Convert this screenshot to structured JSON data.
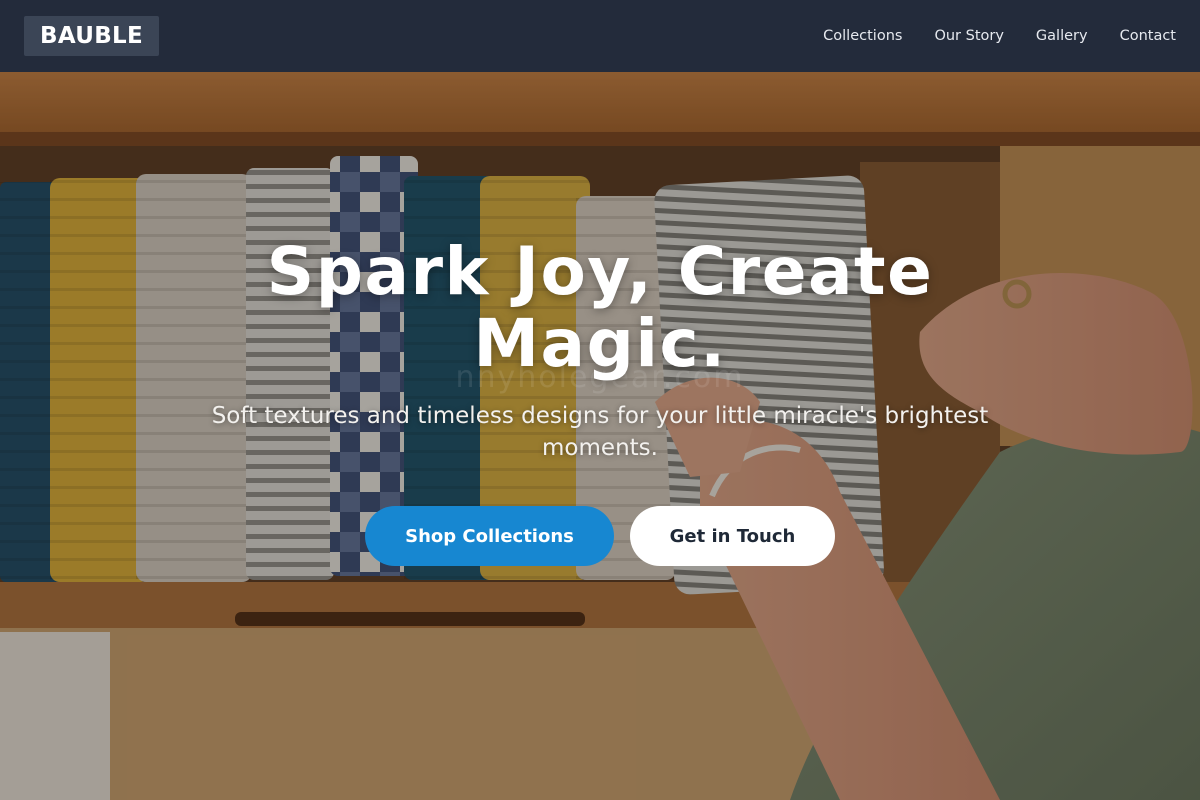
{
  "brand": {
    "logo_text": "BAUBLE"
  },
  "nav": {
    "links": [
      {
        "label": "Collections"
      },
      {
        "label": "Our Story"
      },
      {
        "label": "Gallery"
      },
      {
        "label": "Contact"
      }
    ]
  },
  "hero": {
    "title": "Spark Joy, Create Magic.",
    "subtitle": "Soft textures and timeless designs for your little miracle's brightest moments.",
    "watermark": "nnyholegear.com",
    "image_subject": "drawer-of-folded-muslin-blankets",
    "primary_cta": "Shop Collections",
    "secondary_cta": "Get in Touch"
  },
  "colors": {
    "header_bg": "#232b3b",
    "logo_bg": "#3b4556",
    "primary_button": "#1787d1",
    "secondary_button": "#ffffff"
  }
}
